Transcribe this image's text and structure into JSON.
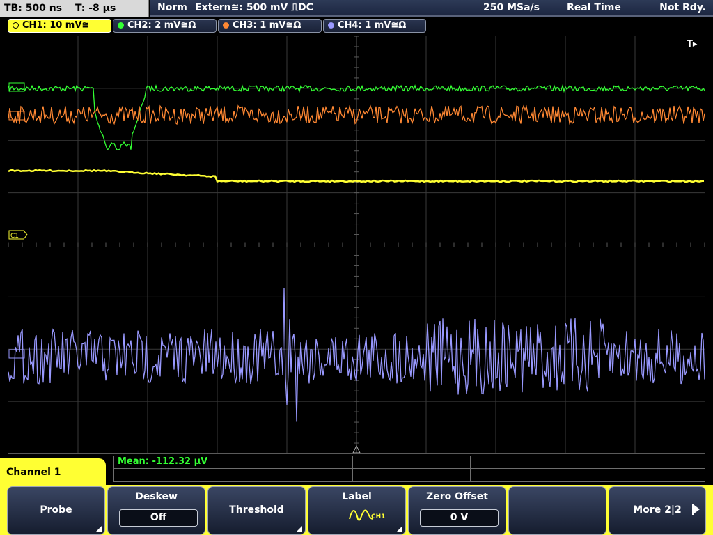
{
  "topbar": {
    "timebase": "TB: 500 ns",
    "trigger_time": "T: -8 µs",
    "mode": "Norm",
    "trigger_source": "Extern≅: 500 mV ⎍DC",
    "sample_rate": "250 MSa/s",
    "acq_mode": "Real Time",
    "status": "Not Rdy."
  },
  "channels": [
    {
      "label": "CH1: 10 mV≅",
      "color": "#ffff33",
      "active": true
    },
    {
      "label": "CH2: 2 mV≅Ω",
      "color": "#33ff33",
      "active": false
    },
    {
      "label": "CH3: 1 mV≅Ω",
      "color": "#ff8833",
      "active": false
    },
    {
      "label": "CH4: 1 mV≅Ω",
      "color": "#9999ff",
      "active": false
    }
  ],
  "display": {
    "trigger_marker": "T▸",
    "ch1_marker": "C1",
    "grid": true
  },
  "measurement": {
    "mean": "Mean: -112.32 µV"
  },
  "menu": {
    "channel_title": "Channel 1",
    "softkeys": [
      {
        "title": "Probe"
      },
      {
        "title": "Deskew",
        "value": "Off"
      },
      {
        "title": "Threshold"
      },
      {
        "title": "Label",
        "icon_text": "CH1"
      },
      {
        "title": "Zero Offset",
        "value": "0 V"
      },
      {
        "title": ""
      },
      {
        "title": "More 2|2"
      }
    ]
  }
}
